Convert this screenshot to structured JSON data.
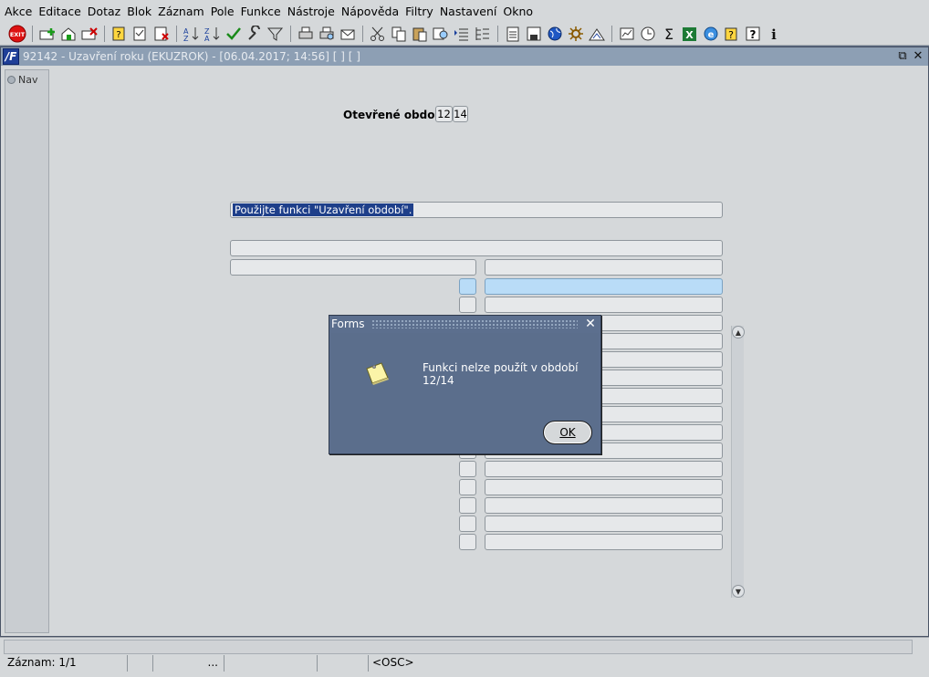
{
  "menu": [
    {
      "label": "Akce"
    },
    {
      "label": "Editace"
    },
    {
      "label": "Dotaz"
    },
    {
      "label": "Blok"
    },
    {
      "label": "Záznam"
    },
    {
      "label": "Pole"
    },
    {
      "label": "Funkce"
    },
    {
      "label": "Nástroje"
    },
    {
      "label": "Nápověda"
    },
    {
      "label": "Filtry"
    },
    {
      "label": "Nastavení"
    },
    {
      "label": "Okno"
    }
  ],
  "toolbar": {
    "exit_label": "EXIT",
    "icons": [
      "exit-icon",
      "insert-record-icon",
      "save-record-icon",
      "delete-record-icon",
      "query-icon",
      "execute-query-icon",
      "cancel-query-icon",
      "sort-asc-icon",
      "sort-desc-icon",
      "check-icon",
      "wrench-icon",
      "filter-icon",
      "print-icon",
      "print-preview-icon",
      "email-icon",
      "scissors-icon",
      "copy-icon",
      "paste-icon",
      "search-icon",
      "list-icon",
      "tree-icon",
      "document-icon",
      "save-icon",
      "globe-icon",
      "settings-icon",
      "chart-icon",
      "notes-icon",
      "clock-icon",
      "sum-icon",
      "excel-icon",
      "ie-icon",
      "help-query-icon",
      "help-icon",
      "info-icon"
    ]
  },
  "window": {
    "title": "92142 - Uzavření roku (EKUZROK) - [06.04.2017; 14:56]  [ ]  [ ]",
    "nav_label": "Nav"
  },
  "form": {
    "period_label": "Otevřené období",
    "period_month": "12",
    "period_year": "14",
    "message": "Použijte funkci \"Uzavření období\".",
    "row_count": 15
  },
  "dialog": {
    "title": "Forms",
    "message": "Funkci nelze použít v období 12/14",
    "ok_label": "OK"
  },
  "status": {
    "record": "Záznam: 1/1",
    "ellipsis": "...",
    "mode": "<OSC>"
  }
}
